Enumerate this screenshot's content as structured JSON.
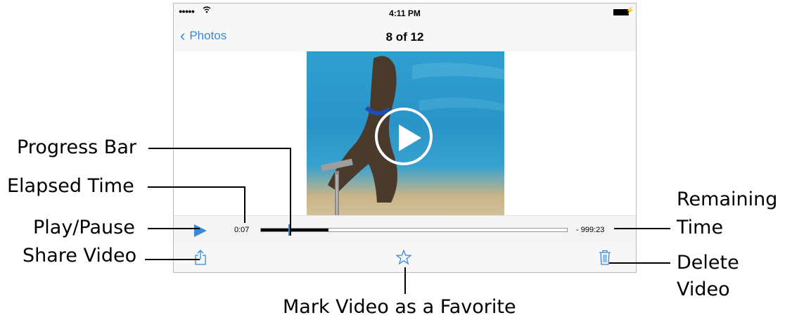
{
  "status_bar": {
    "signal": "●●●●● ",
    "time": "4:11 PM"
  },
  "nav_bar": {
    "back_label": "Photos",
    "title": "8 of 12"
  },
  "player": {
    "elapsed": "0:07",
    "remaining": "- 999:23",
    "progress": 0.22
  },
  "toolbar": {
    "share": "share-icon",
    "favorite": "star-icon",
    "delete": "trash-icon"
  },
  "callouts": {
    "progress_bar": "Progress Bar",
    "elapsed_time": "Elapsed Time",
    "play_pause": "Play/Pause",
    "share_video": "Share Video",
    "remaining_time_1": "Remaining",
    "remaining_time_2": "Time",
    "delete_video_1": "Delete",
    "delete_video_2": "Video",
    "mark_favorite": "Mark Video as a Favorite"
  },
  "colors": {
    "accent": "#3a88d6",
    "bar_bg": "#f7f7f7"
  }
}
